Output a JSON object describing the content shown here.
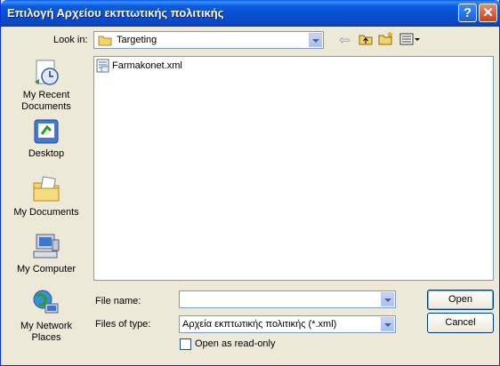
{
  "window": {
    "title": "Επιλογή Αρχείου εκπτωτικής πολιτικής",
    "help_glyph": "?",
    "close_glyph": "✕"
  },
  "lookin": {
    "label": "Look in:",
    "value": "Targeting"
  },
  "toolbar": {
    "back_arrow": "⇦"
  },
  "places": [
    {
      "label": "My Recent Documents"
    },
    {
      "label": "Desktop"
    },
    {
      "label": "My Documents"
    },
    {
      "label": "My Computer"
    },
    {
      "label": "My Network Places"
    }
  ],
  "files": [
    {
      "name": "Farmakonet.xml"
    }
  ],
  "filename": {
    "label": "File name:",
    "value": ""
  },
  "filetype": {
    "label": "Files of type:",
    "value": "Αρχεία εκπτωτικής πολιτικής (*.xml)"
  },
  "readonly": {
    "label": "Open as read-only"
  },
  "buttons": {
    "open": "Open",
    "cancel": "Cancel"
  }
}
